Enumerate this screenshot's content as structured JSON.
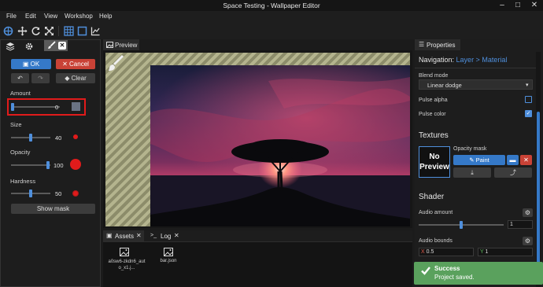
{
  "window": {
    "title": "Space Testing - Wallpaper Editor"
  },
  "menu": [
    "File",
    "Edit",
    "View",
    "Workshop",
    "Help"
  ],
  "left_panel": {
    "ok_label": "OK",
    "cancel_label": "Cancel",
    "clear_label": "Clear",
    "amount": {
      "label": "Amount",
      "value": "0"
    },
    "size": {
      "label": "Size",
      "value": "40"
    },
    "opacity": {
      "label": "Opacity",
      "value": "100"
    },
    "hardness": {
      "label": "Hardness",
      "value": "50"
    },
    "show_mask_label": "Show mask"
  },
  "preview": {
    "tab_label": "Preview"
  },
  "bottom": {
    "tabs": [
      {
        "label": "Assets"
      },
      {
        "label": "Log"
      }
    ],
    "assets": [
      {
        "name": "a0sw6-zkdn6_auto_x1.j..."
      },
      {
        "name": "bar.json"
      }
    ]
  },
  "properties": {
    "tab_label": "Properties",
    "navigation": {
      "prefix": "Navigation:",
      "path": "Layer > Material"
    },
    "blend_mode": {
      "label": "Blend mode",
      "value": "Linear dodge"
    },
    "pulse_alpha": {
      "label": "Pulse alpha",
      "checked": false
    },
    "pulse_color": {
      "label": "Pulse color",
      "checked": true
    },
    "textures_title": "Textures",
    "no_preview_text": "No Preview",
    "opacity_mask_label": "Opacity mask",
    "paint_label": "Paint",
    "shader_title": "Shader",
    "audio_amount": {
      "label": "Audio amount",
      "value": "1"
    },
    "audio_bounds": {
      "label": "Audio bounds",
      "x_label": "X",
      "x_value": "0.5",
      "y_label": "Y",
      "y_value": "1"
    }
  },
  "toast": {
    "title": "Success",
    "message": "Project saved."
  },
  "colors": {
    "accent": "#3579c8",
    "danger": "#c94236",
    "success": "#5aa15d",
    "highlight": "#e11b1b"
  }
}
